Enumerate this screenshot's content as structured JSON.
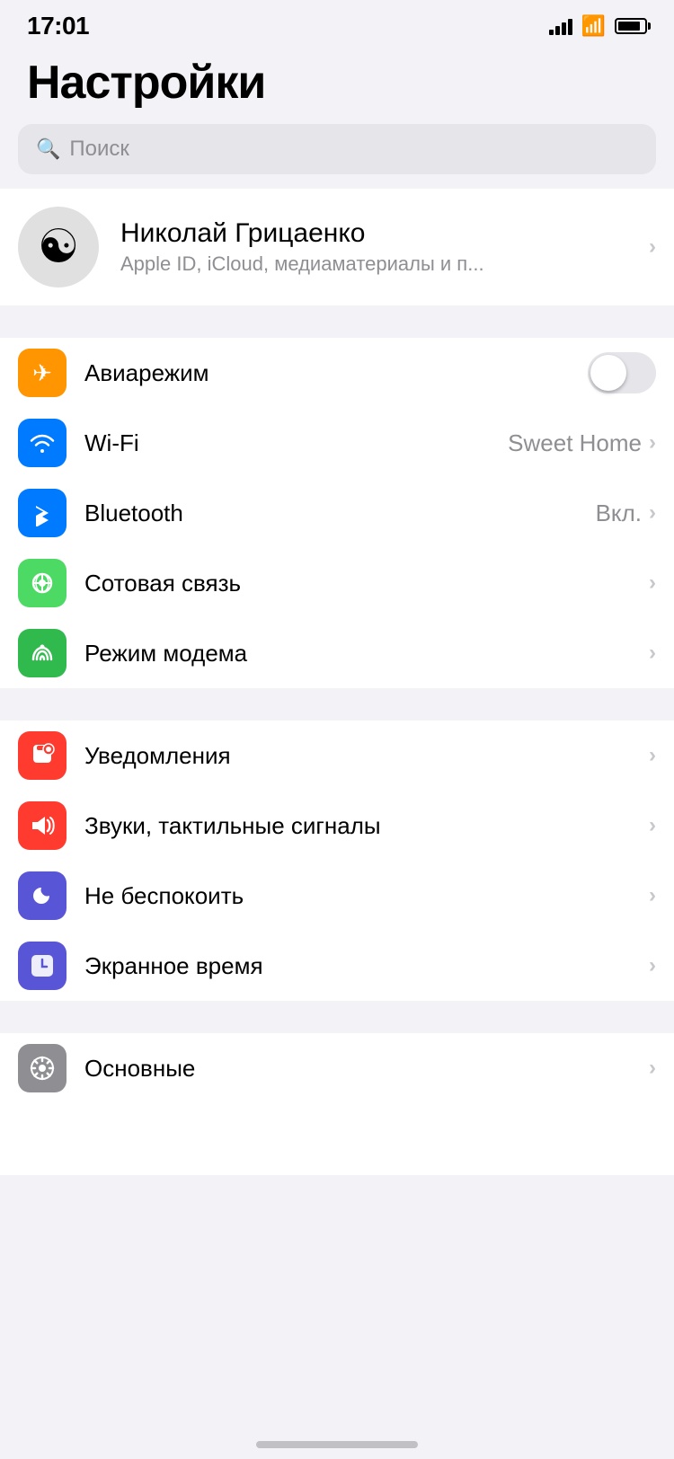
{
  "statusBar": {
    "time": "17:01",
    "locationArrow": "›"
  },
  "pageTitle": "Настройки",
  "search": {
    "placeholder": "Поиск"
  },
  "profile": {
    "name": "Николай Грицаенко",
    "subtitle": "Apple ID, iCloud, медиаматериалы и п...",
    "emoji": "☯"
  },
  "connectivity": [
    {
      "id": "airplane",
      "label": "Авиарежим",
      "iconBg": "icon-orange",
      "iconSymbol": "✈",
      "valueType": "toggle",
      "toggleOn": false
    },
    {
      "id": "wifi",
      "label": "Wi-Fi",
      "iconBg": "icon-blue",
      "iconSymbol": "📶",
      "valueType": "text",
      "value": "Sweet Home"
    },
    {
      "id": "bluetooth",
      "label": "Bluetooth",
      "iconBg": "icon-blue",
      "iconSymbol": "⬡",
      "valueType": "text",
      "value": "Вкл."
    },
    {
      "id": "cellular",
      "label": "Сотовая связь",
      "iconBg": "icon-green",
      "iconSymbol": "📡",
      "valueType": "chevron"
    },
    {
      "id": "hotspot",
      "label": "Режим модема",
      "iconBg": "icon-green2",
      "iconSymbol": "∞",
      "valueType": "chevron"
    }
  ],
  "notifications": [
    {
      "id": "notifications",
      "label": "Уведомления",
      "iconBg": "icon-red",
      "iconSymbol": "🔔",
      "valueType": "chevron"
    },
    {
      "id": "sounds",
      "label": "Звуки, тактильные сигналы",
      "iconBg": "icon-red2",
      "iconSymbol": "🔊",
      "valueType": "chevron"
    },
    {
      "id": "donotdisturb",
      "label": "Не беспокоить",
      "iconBg": "icon-purple",
      "iconSymbol": "🌙",
      "valueType": "chevron"
    },
    {
      "id": "screentime",
      "label": "Экранное время",
      "iconBg": "icon-purple2",
      "iconSymbol": "⌛",
      "valueType": "chevron"
    }
  ],
  "general": [
    {
      "id": "general",
      "label": "Основные",
      "iconBg": "icon-gray",
      "iconSymbol": "⚙",
      "valueType": "chevron"
    }
  ]
}
